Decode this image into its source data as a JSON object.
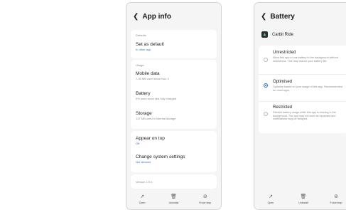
{
  "app_info": {
    "title": "App info",
    "defaults_label": "Defaults",
    "set_as_default": {
      "title": "Set as default",
      "subtitle": "In other app"
    },
    "usage_label": "Usage",
    "mobile_data": {
      "title": "Mobile data",
      "subtitle": "7.35 MB used since Nov 3"
    },
    "battery": {
      "title": "Battery",
      "subtitle": "0% used since last fully charged"
    },
    "storage": {
      "title": "Storage",
      "subtitle": "137 MB used in internal storage"
    },
    "appear_on_top": {
      "title": "Appear on top",
      "subtitle": "Off"
    },
    "change_system_settings": {
      "title": "Change system settings",
      "subtitle": "Not allowed"
    },
    "version": "Version 1.9.0",
    "bottom_bar": {
      "open": "Open",
      "uninstall": "Uninstall",
      "force_stop": "Force stop"
    }
  },
  "battery_page": {
    "title": "Battery",
    "app_name": "Carbit Ride",
    "options": [
      {
        "title": "Unrestricted",
        "desc": "Allow this app to use battery in the background without restrictions. This may reduce your battery life.",
        "selected": false
      },
      {
        "title": "Optimised",
        "desc": "Optimise based on your usage of this app. Recommended for most apps.",
        "selected": true
      },
      {
        "title": "Restricted",
        "desc": "Restrict battery usage while this app is running in the background. The app may not work as expected and notifications may be delayed.",
        "selected": false
      }
    ],
    "bottom_bar": {
      "open": "Open",
      "uninstall": "Uninstall",
      "force_stop": "Force stop"
    }
  },
  "icons": {
    "back": "chevron-left-icon",
    "open": "open-external-icon",
    "uninstall": "trash-icon",
    "force_stop": "stop-icon",
    "app": "carbit-ride-app-icon"
  },
  "colors": {
    "accent": "#2a64c6",
    "link": "#3a78c5",
    "background": "#f5f5f5",
    "card": "#ffffff"
  }
}
